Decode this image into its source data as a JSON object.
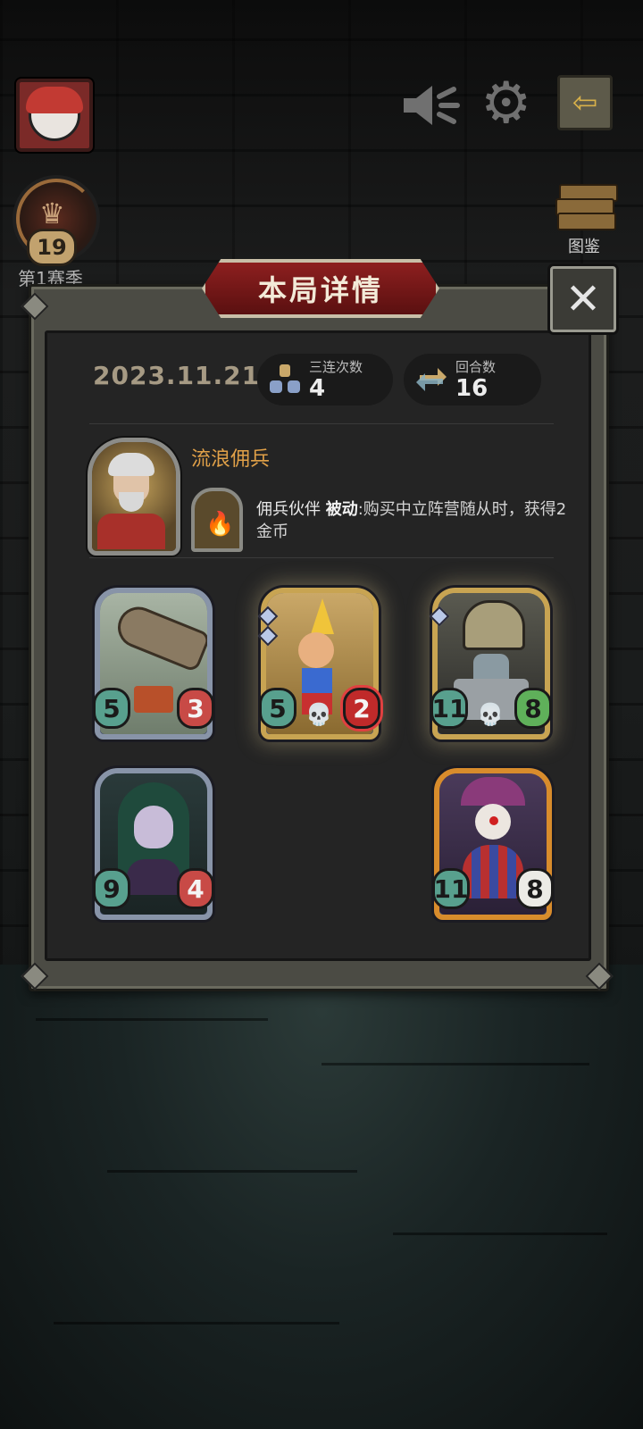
{
  "hud": {
    "season_label": "第1赛季",
    "rank_level": "19",
    "codex_label": "图鉴"
  },
  "panel": {
    "title": "本局详情",
    "close_symbol": "✕",
    "date": "2023.11.21",
    "stats": [
      {
        "label": "三连次数",
        "value": "4",
        "icon": "triple-icon"
      },
      {
        "label": "回合数",
        "value": "16",
        "icon": "rounds-icon"
      }
    ],
    "hero": {
      "name": "流浪佣兵",
      "skill_name": "佣兵伙伴",
      "skill_type": "被动",
      "skill_text": ":购买中立阵营随从时，获得2金币"
    },
    "minions": [
      {
        "name": "zeppelin",
        "attack": "5",
        "health": "3",
        "frame": "silver",
        "golden": false,
        "skull": false
      },
      {
        "name": "pinocchio",
        "attack": "5",
        "health": "2",
        "frame": "silver",
        "golden": true,
        "skull": true
      },
      {
        "name": "bell-robot",
        "attack": "11",
        "health": "8",
        "frame": "silver",
        "golden": true,
        "skull": true
      },
      {
        "name": "demon-elf",
        "attack": "9",
        "health": "4",
        "frame": "silver",
        "golden": false,
        "skull": false
      },
      {
        "name": "clown",
        "attack": "11",
        "health": "8",
        "frame": "orange",
        "golden": false,
        "skull": false
      }
    ]
  },
  "colors": {
    "accent_orange": "#e0a048",
    "attack_green": "#58a08e",
    "health_red": "#c84a46",
    "title_red": "#8d1f1f"
  }
}
